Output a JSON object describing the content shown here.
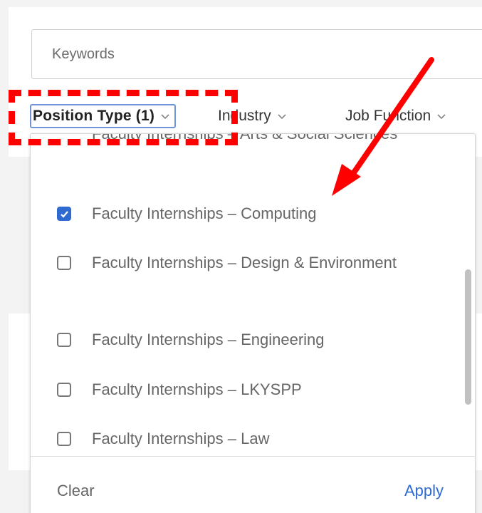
{
  "search": {
    "placeholder": "Keywords"
  },
  "filters": [
    {
      "label": "Position Type (1)",
      "active": true
    },
    {
      "label": "Industry",
      "active": false
    },
    {
      "label": "Job Function",
      "active": false
    }
  ],
  "dropdown": {
    "options": [
      {
        "label": "Faculty Internships – Arts & Social Sciences",
        "checked": false
      },
      {
        "label": "Faculty Internships – Computing",
        "checked": true
      },
      {
        "label": "Faculty Internships – Design & Environment",
        "checked": false
      },
      {
        "label": "Faculty Internships – Engineering",
        "checked": false
      },
      {
        "label": "Faculty Internships – LKYSPP",
        "checked": false
      },
      {
        "label": "Faculty Internships – Law",
        "checked": false
      }
    ],
    "clear_label": "Clear",
    "apply_label": "Apply"
  },
  "colors": {
    "accent": "#2f6ad0",
    "annotation": "#ff0000"
  },
  "icons": {
    "chevron": "chevron-down-icon",
    "check": "check-icon"
  }
}
